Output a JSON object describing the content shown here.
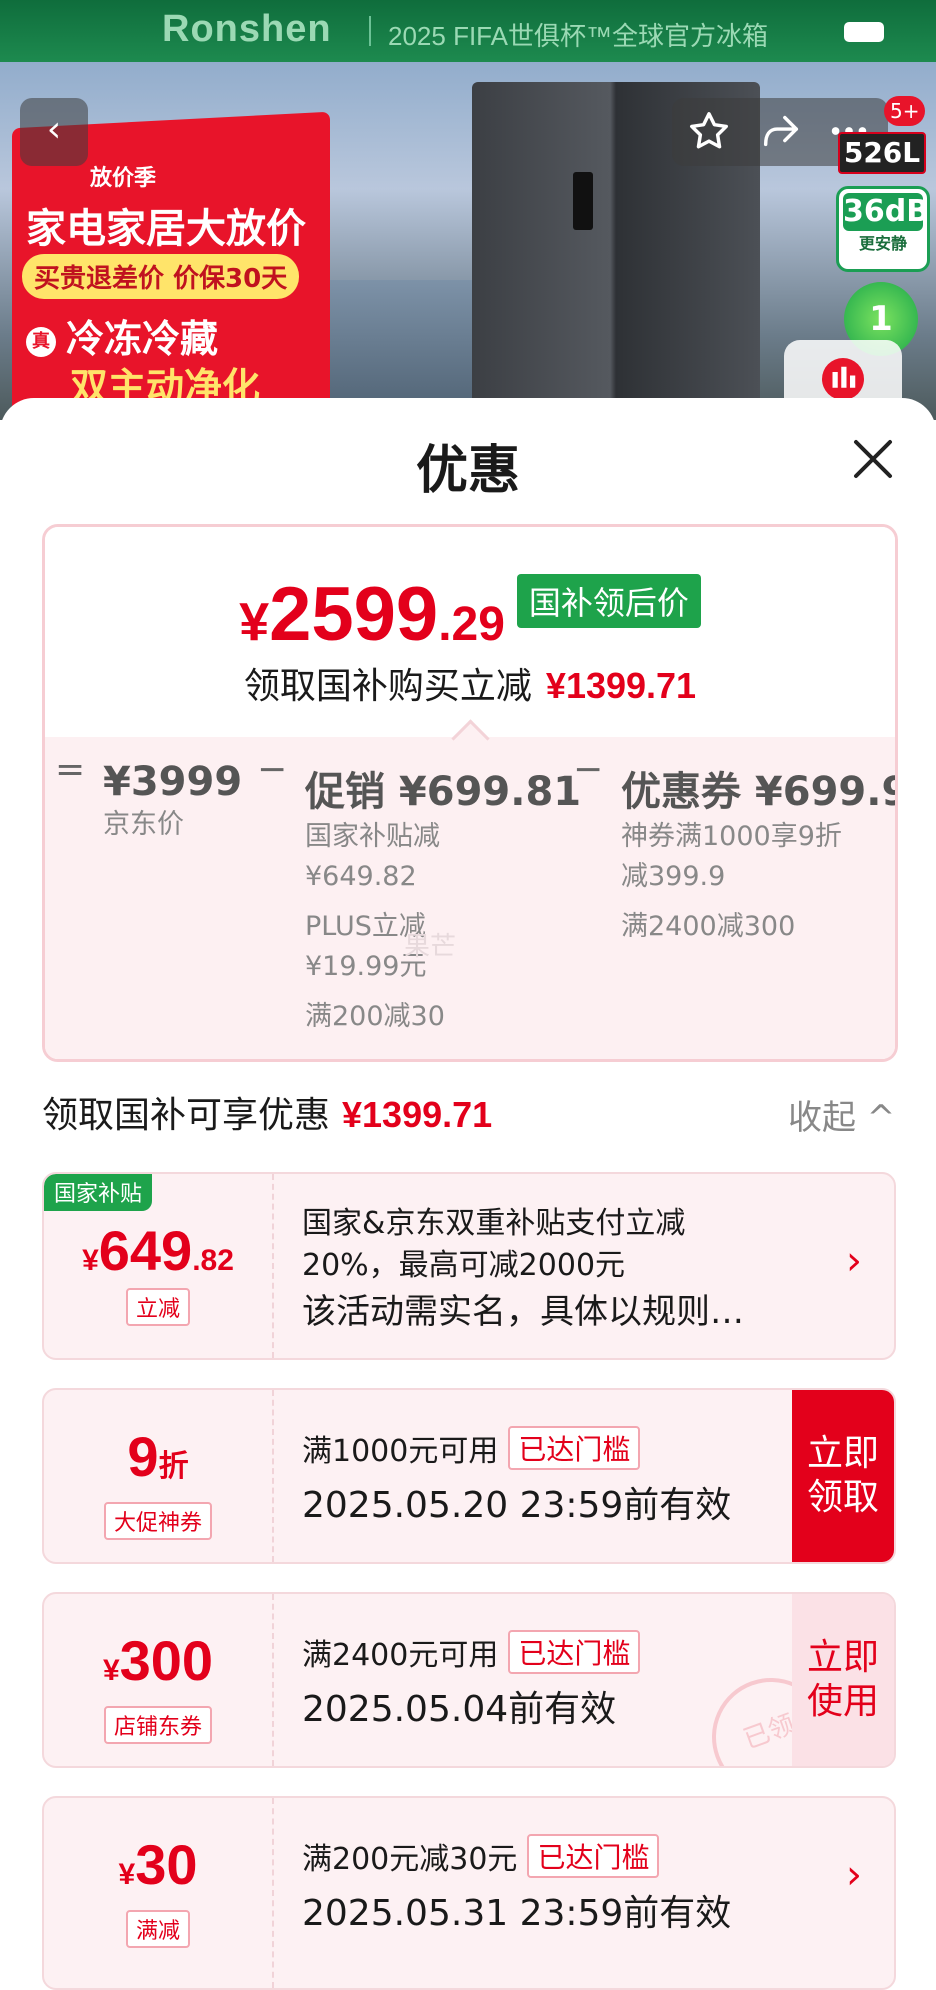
{
  "banner": {
    "brand": "Ronshen",
    "brand_text": "2025 FIFA世俱杯™全球官方冰箱",
    "promo_tag": "放价季",
    "promo_title": "家电家居大放价",
    "promo_pill": "买贵退差价 价保30天",
    "promo_zhen": "真",
    "promo_line1": "冷冻冷藏",
    "promo_line2": "双主动净化",
    "back_icon": "‹",
    "badge_count": "5+",
    "capacity": "526L",
    "noise": "36dB",
    "noise_sub": "更安静",
    "energy": "1"
  },
  "sheet": {
    "title": "优惠",
    "price": {
      "currency": "¥",
      "int": "2599",
      "dec": ".29",
      "tag": "国补领后价"
    },
    "save": {
      "label": "领取国补购买立减",
      "amount": "¥1399.71"
    },
    "breakdown": {
      "eq": "=",
      "minus": "−",
      "jd_price": "¥3999",
      "jd_label": "京东价",
      "promo_main": "促销 ¥699.81",
      "promo_items": [
        "国家补贴减",
        "¥649.82",
        "PLUS立减",
        "¥19.99元",
        "满200减30"
      ],
      "coupon_main": "优惠券 ¥699.9",
      "coupon_items": [
        "神券满1000享9折",
        "减399.9",
        "满2400减300"
      ]
    },
    "watermark": "果芒",
    "summary": {
      "label": "领取国补可享优惠",
      "amount": "¥1399.71",
      "collapse": "收起 ^"
    },
    "coupons": [
      {
        "corner": "国家补贴",
        "amt_prefix": "¥",
        "amt_main": "649",
        "amt_suffix": ".82",
        "label": "立减",
        "line1": "国家&京东双重补贴支付立减",
        "line2": "20%，最高可减2000元",
        "line3": "该活动需实名，具体以规则…"
      },
      {
        "amt_main": "9",
        "amt_suffix": "折",
        "label": "大促神券",
        "line1": "满1000元可用",
        "badge": "已达门槛",
        "line2": "2025.05.20 23:59前有效",
        "action": [
          "立即",
          "领取"
        ]
      },
      {
        "amt_prefix": "¥",
        "amt_main": "300",
        "label": "店铺东券",
        "line1": "满2400元可用",
        "badge": "已达门槛",
        "line2": "2025.05.04前有效",
        "action": [
          "立即",
          "使用"
        ],
        "stamp": "已领"
      },
      {
        "amt_prefix": "¥",
        "amt_main": "30",
        "label": "满减",
        "line1": "满200元减30元",
        "badge": "已达门槛",
        "line2": "2025.05.31 23:59前有效"
      }
    ]
  },
  "colors": {
    "accent_red": "#e3001b",
    "green": "#1ea34b",
    "pink_bg": "#fdf0f2"
  }
}
